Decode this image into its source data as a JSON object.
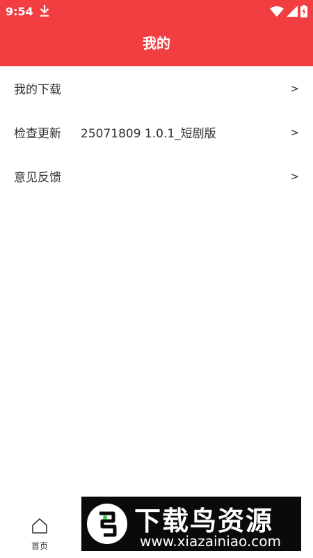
{
  "status_bar": {
    "time": "9:54",
    "icons": [
      "download-icon",
      "wifi-icon",
      "cellular-signal-icon",
      "battery-charging-icon"
    ]
  },
  "header": {
    "title": "我的",
    "background_color": "#f23d41"
  },
  "menu": {
    "items": [
      {
        "label": "我的下载",
        "value": "",
        "chevron": ">"
      },
      {
        "label": "检查更新",
        "value": "25071809 1.0.1_短剧版",
        "chevron": ">"
      },
      {
        "label": "意见反馈",
        "value": "",
        "chevron": ">"
      }
    ]
  },
  "tabbar": {
    "items": [
      {
        "label": "首页",
        "icon": "home-icon"
      }
    ]
  },
  "watermark": {
    "brand": "下载鸟资源",
    "url": "www.xiazainiao.com"
  }
}
